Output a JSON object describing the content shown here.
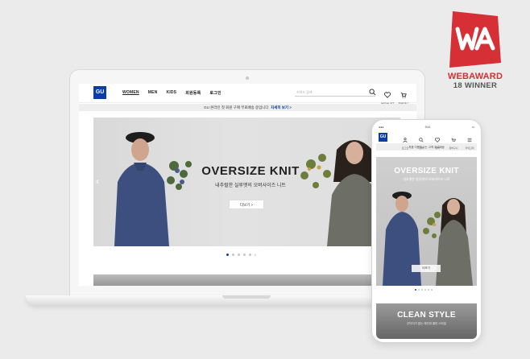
{
  "award": {
    "monogram": "WA",
    "title": "WEBAWARD",
    "subtitle": "18 WINNER",
    "color": "#d62f36"
  },
  "desktop": {
    "logo": "GU",
    "nav": [
      "WOMEN",
      "MEN",
      "KIDS",
      "회원등록",
      "로그인"
    ],
    "search_placeholder": "키워드 검색",
    "icons": [
      {
        "name": "heart-icon",
        "label": "WISHLIST"
      },
      {
        "name": "cart-icon",
        "label": "장바구니"
      }
    ],
    "notice": "GU 온라인 첫 회원 구매 무료배송 중입니다",
    "notice_link": "자세히 보기 >",
    "hero": {
      "title": "OVERSIZE KNIT",
      "subtitle": "내추럴한 실루엣의 오버사이즈 니트",
      "button": "더보기  >"
    },
    "slide_count": 6,
    "active_slide": 1
  },
  "mobile": {
    "time": "9:41",
    "logo": "GU",
    "icons": [
      {
        "name": "user-icon",
        "label": "로그인"
      },
      {
        "name": "search-icon",
        "label": "검색"
      },
      {
        "name": "heart-icon",
        "label": "위시"
      },
      {
        "name": "cart-icon",
        "label": "장바구니"
      },
      {
        "name": "menu-icon",
        "label": "카테고리"
      }
    ],
    "notice": "처음 이용하시는 고객 무료배송",
    "hero": {
      "title": "OVERSIZE KNIT",
      "subtitle": "내추럴한 실루엣의 오버사이즈 니트",
      "button": "더보기"
    },
    "second": {
      "title": "CLEAN STYLE",
      "subtitle": "군더더기 없는 깨끗한 클린 스타일"
    }
  },
  "colors": {
    "brand": "#0b3ea3",
    "background": "#ebebeb"
  }
}
